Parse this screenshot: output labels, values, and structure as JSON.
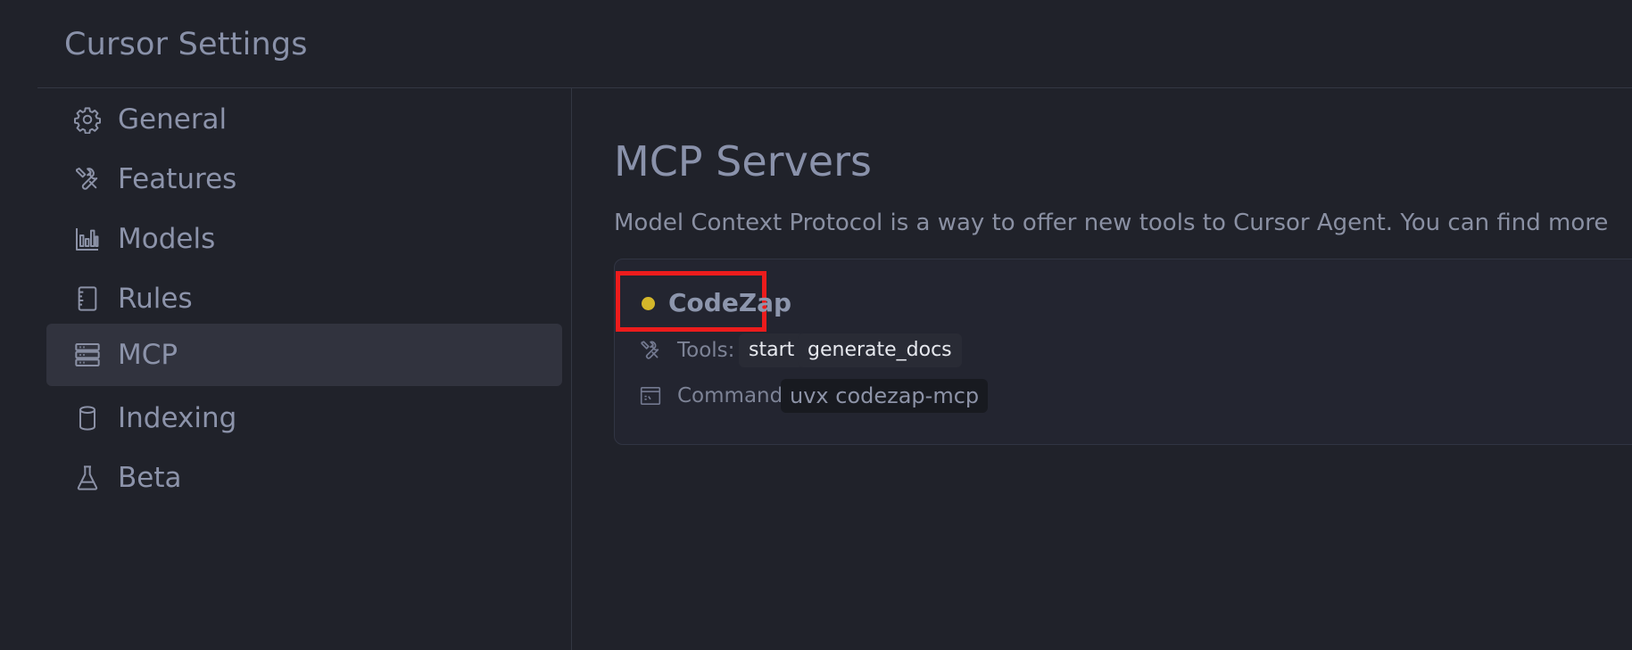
{
  "window": {
    "title": "Cursor Settings"
  },
  "sidebar": {
    "items": [
      {
        "label": "General",
        "icon": "gear-icon",
        "active": false
      },
      {
        "label": "Features",
        "icon": "tools-icon",
        "active": false
      },
      {
        "label": "Models",
        "icon": "bar-chart-icon",
        "active": false
      },
      {
        "label": "Rules",
        "icon": "ruler-notebook-icon",
        "active": false
      },
      {
        "label": "MCP",
        "icon": "server-icon",
        "active": true
      },
      {
        "label": "Indexing",
        "icon": "database-icon",
        "active": false
      },
      {
        "label": "Beta",
        "icon": "flask-icon",
        "active": false
      }
    ]
  },
  "main": {
    "title": "MCP Servers",
    "description": "Model Context Protocol is a way to offer new tools to Cursor Agent. You can find more"
  },
  "server": {
    "name": "CodeZap",
    "status_color": "#d4b72a",
    "tools_label": "Tools:",
    "tools": [
      "start",
      "generate_docs"
    ],
    "command_label": "Command:",
    "command": "uvx codezap-mcp"
  },
  "colors": {
    "background": "#20222a",
    "active_item": "#31333e",
    "highlight_border": "#ec1c1c"
  }
}
